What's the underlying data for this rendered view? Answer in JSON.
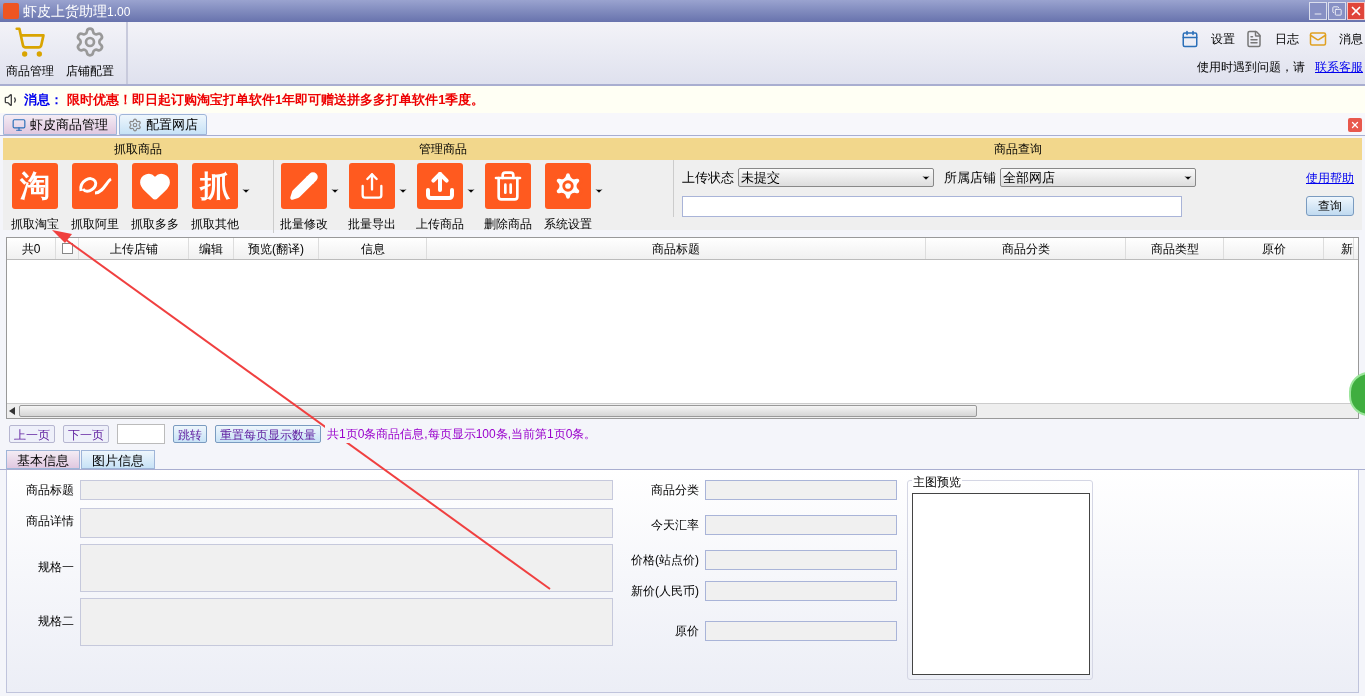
{
  "window": {
    "title": "虾皮上货助理",
    "version": "1.00"
  },
  "toolbar": {
    "items": [
      {
        "label": "商品管理"
      },
      {
        "label": "店铺配置"
      }
    ],
    "menu": [
      {
        "label": "设置"
      },
      {
        "label": "日志"
      },
      {
        "label": "消息"
      }
    ],
    "help_text": "使用时遇到问题，请",
    "help_link": "联系客服"
  },
  "notice": {
    "label": "消息：",
    "text": "限时优惠！即日起订购淘宝打单软件1年即可赠送拼多多打单软件1季度。"
  },
  "tabs": [
    {
      "label": "虾皮商品管理",
      "selected": true
    },
    {
      "label": "配置网店",
      "selected": false
    }
  ],
  "ribbon": {
    "groups": [
      {
        "title": "抓取商品",
        "buttons": [
          {
            "label": "抓取淘宝",
            "kind": "glyph",
            "glyph": "淘",
            "dropdown": false
          },
          {
            "label": "抓取阿里",
            "kind": "ali",
            "dropdown": false
          },
          {
            "label": "抓取多多",
            "kind": "heart",
            "dropdown": false
          },
          {
            "label": "抓取其他",
            "kind": "glyph",
            "glyph": "抓",
            "dropdown": true
          }
        ]
      },
      {
        "title": "管理商品",
        "buttons": [
          {
            "label": "批量修改",
            "kind": "pencil",
            "dropdown": true
          },
          {
            "label": "批量导出",
            "kind": "export",
            "dropdown": true
          },
          {
            "label": "上传商品",
            "kind": "upload",
            "dropdown": true
          },
          {
            "label": "删除商品",
            "kind": "trash",
            "dropdown": false
          },
          {
            "label": "系统设置",
            "kind": "gear",
            "dropdown": true
          }
        ]
      }
    ],
    "query": {
      "title": "商品查询",
      "status_label": "上传状态",
      "status_value": "未提交",
      "shop_label": "所属店铺",
      "shop_value": "全部网店",
      "help_link": "使用帮助",
      "button": "查询"
    }
  },
  "table": {
    "count": "共0",
    "checked": false,
    "columns": [
      "上传店铺",
      "编辑",
      "预览(翻译)",
      "信息",
      "商品标题",
      "商品分类",
      "商品类型",
      "原价",
      "新"
    ]
  },
  "pager": {
    "prev": "上一页",
    "next": "下一页",
    "jump": "跳转",
    "reset": "重置每页显示数量",
    "info": "共1页0条商品信息,每页显示100条,当前第1页0条。"
  },
  "detail_tabs": [
    {
      "label": "基本信息",
      "selected": true
    },
    {
      "label": "图片信息",
      "selected": false
    }
  ],
  "detail": {
    "left": [
      {
        "label": "商品标题",
        "kind": "single"
      },
      {
        "label": "商品详情",
        "kind": "double"
      },
      {
        "label": "规格一",
        "kind": "tall"
      },
      {
        "label": "规格二",
        "kind": "tall"
      }
    ],
    "right": [
      {
        "label": "商品分类"
      },
      {
        "label": "今天汇率"
      },
      {
        "label": "价格(站点价)"
      },
      {
        "label": "新价(人民币)"
      },
      {
        "label": "原价"
      }
    ],
    "preview_title": "主图预览"
  }
}
